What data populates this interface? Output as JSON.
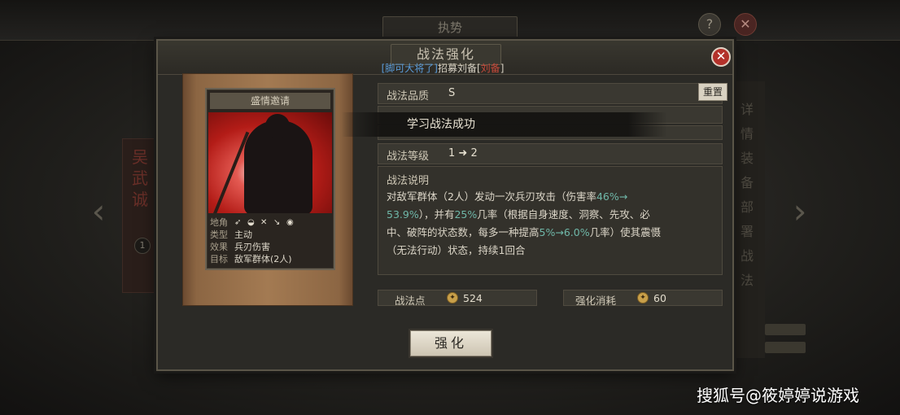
{
  "background": {
    "title": "执势",
    "help_label": "?",
    "close_label": "✕",
    "left_side_text": "吴\n武\n诚",
    "left_badge": "1",
    "right_side_text": "详\n情\n装\n备\n部\n署\n战\n法"
  },
  "dialog": {
    "title": "战法强化",
    "subtitle_prefix": "[脚可大将了]",
    "subtitle_middle": "招募刘备[",
    "subtitle_red": "刘备",
    "subtitle_suffix": "]",
    "close_label": "✕"
  },
  "card": {
    "name": "盛情邀请",
    "info": [
      {
        "key": "地角",
        "value": ""
      },
      {
        "key": "类型",
        "value": "主动"
      },
      {
        "key": "效果",
        "value": "兵刃伤害"
      },
      {
        "key": "目标",
        "value": "敌军群体(2人)"
      }
    ],
    "role_icons": [
      "spear-icon",
      "shield-icon",
      "crossed-swords-icon",
      "bow-icon",
      "cavalry-icon"
    ]
  },
  "details": {
    "quality_label": "战法品质",
    "quality_value": "S",
    "reset_label": "重置",
    "toast": "学习战法成功",
    "level_label": "战法等级",
    "level_from": "1",
    "level_arrow": "➜",
    "level_to": "2",
    "desc_title": "战法说明",
    "desc_line1_a": "对敌军群体（2人）发动一次兵刃攻击（伤害率",
    "desc_line1_hl": "46%→",
    "desc_line2_hl": "53.9%",
    "desc_line2_a": "），并有",
    "desc_line2_hl2": "25%",
    "desc_line2_b": "几率（根据自身速度、洞察、先攻、必",
    "desc_line3_a": "中、破阵的状态数，每多一种提高",
    "desc_line3_hl": "5%→6.0%",
    "desc_line3_b": "几率）使其震慑",
    "desc_line4": "（无法行动）状态，持续1回合"
  },
  "stats": {
    "points_label": "战法点",
    "points_value": "524",
    "cost_label": "强化消耗",
    "cost_value": "60"
  },
  "actions": {
    "enhance_label": "强化"
  },
  "watermark": "搜狐号@筱婷婷说游戏"
}
